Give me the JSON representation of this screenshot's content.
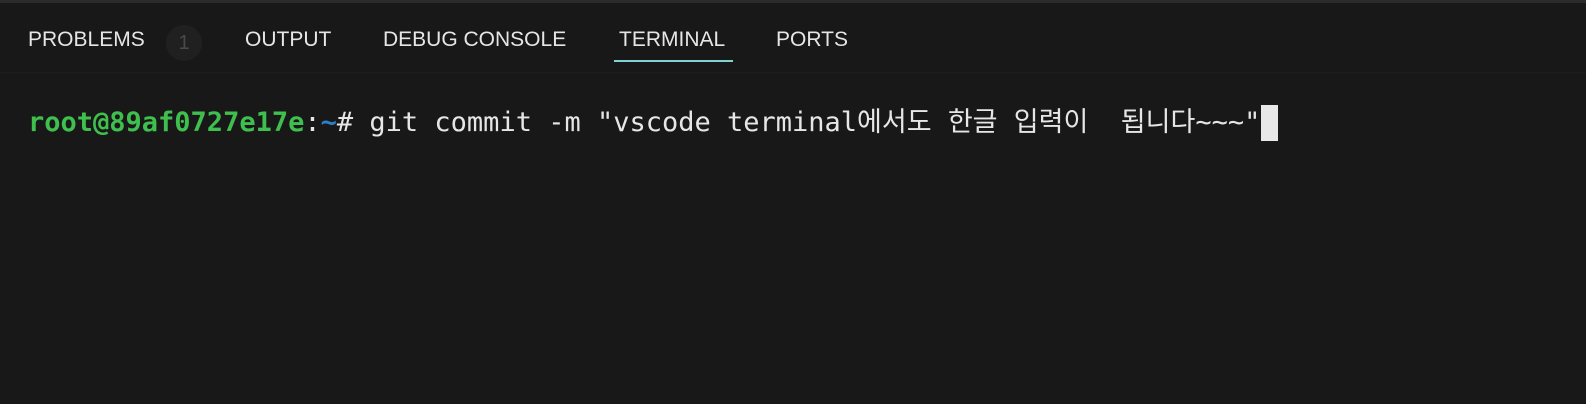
{
  "panel": {
    "tabs": [
      {
        "label": "PROBLEMS",
        "badge": "1"
      },
      {
        "label": "OUTPUT"
      },
      {
        "label": "DEBUG CONSOLE"
      },
      {
        "label": "TERMINAL",
        "active": true
      },
      {
        "label": "PORTS"
      }
    ]
  },
  "terminal": {
    "prompt_user": "root@89af0727e17e",
    "prompt_colon": ":",
    "prompt_path": "~",
    "prompt_symbol": "#",
    "command": " git commit -m \"vscode terminal에서도 한글 입력이  됩니다~~~\""
  },
  "colors": {
    "background": "#181818",
    "text": "#e6e6e6",
    "prompt_user": "#3fbf4e",
    "prompt_path": "#2b7fc9",
    "active_tab_underline": "#7fd3d0",
    "badge_background": "#202020"
  }
}
